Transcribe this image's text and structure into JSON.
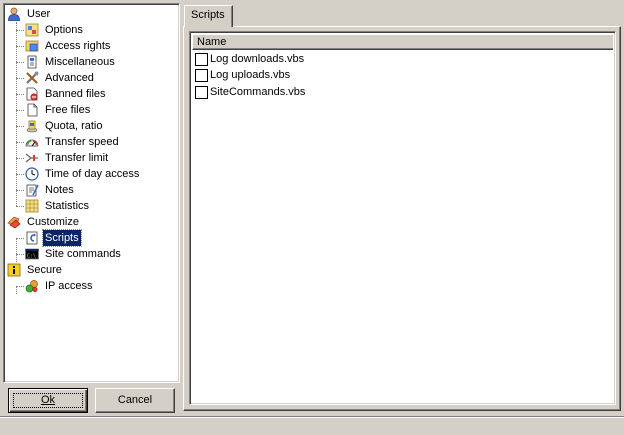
{
  "tree": {
    "items": [
      {
        "label": "User",
        "icon": "user-icon",
        "level": 0
      },
      {
        "label": "Options",
        "icon": "options-icon",
        "level": 1
      },
      {
        "label": "Access rights",
        "icon": "access-rights-icon",
        "level": 1
      },
      {
        "label": "Miscellaneous",
        "icon": "miscellaneous-icon",
        "level": 1
      },
      {
        "label": "Advanced",
        "icon": "advanced-tools-icon",
        "level": 1
      },
      {
        "label": "Banned files",
        "icon": "banned-files-icon",
        "level": 1
      },
      {
        "label": "Free files",
        "icon": "free-files-icon",
        "level": 1
      },
      {
        "label": "Quota, ratio",
        "icon": "quota-icon",
        "level": 1
      },
      {
        "label": "Transfer speed",
        "icon": "speedometer-icon",
        "level": 1
      },
      {
        "label": "Transfer limit",
        "icon": "transfer-limit-icon",
        "level": 1
      },
      {
        "label": "Time of day access",
        "icon": "clock-icon",
        "level": 1
      },
      {
        "label": "Notes",
        "icon": "notes-icon",
        "level": 1
      },
      {
        "label": "Statistics",
        "icon": "statistics-icon",
        "level": 1
      },
      {
        "label": "Customize",
        "icon": "customize-icon",
        "level": 0
      },
      {
        "label": "Scripts",
        "icon": "scripts-icon",
        "level": 1,
        "selected": true
      },
      {
        "label": "Site commands",
        "icon": "command-prompt-icon",
        "level": 1
      },
      {
        "label": "Secure",
        "icon": "secure-icon",
        "level": 0
      },
      {
        "label": "IP access",
        "icon": "ip-access-icon",
        "level": 1
      }
    ]
  },
  "buttons": {
    "ok_label": "Ok",
    "cancel_label": "Cancel"
  },
  "tab": {
    "label": "Scripts"
  },
  "list": {
    "column_header": "Name",
    "items": [
      {
        "label": "Log downloads.vbs",
        "checked": false
      },
      {
        "label": "Log uploads.vbs",
        "checked": false
      },
      {
        "label": "SiteCommands.vbs",
        "checked": false
      }
    ]
  },
  "colors": {
    "window_bg": "#d4d0c8",
    "selection_bg": "#0a246a",
    "selection_text": "#ffffff"
  }
}
